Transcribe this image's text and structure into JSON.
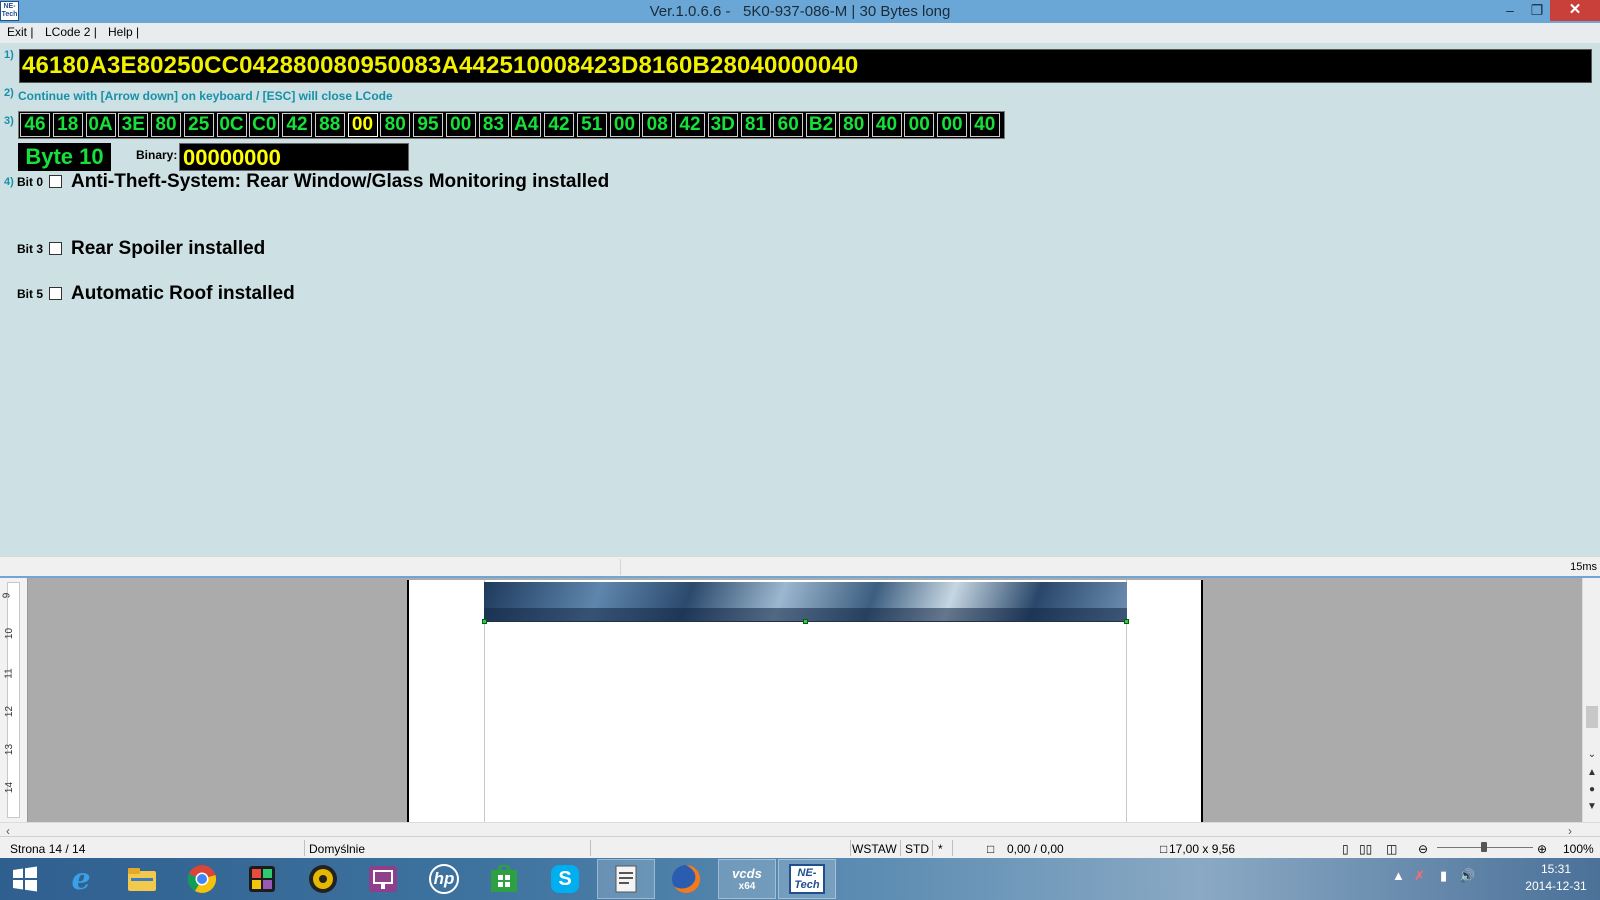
{
  "window": {
    "title": "Ver.1.0.6.6 -   5K0-937-086-M | 30 Bytes long",
    "logo_text": "NE-Tech",
    "minimize_icon": "minimize-icon",
    "maximize_icon": "restore-icon",
    "close_icon": "close-icon"
  },
  "menu": {
    "items": [
      {
        "label": "Exit |"
      },
      {
        "label": "LCode 2 |"
      },
      {
        "label": "Help |"
      }
    ]
  },
  "main": {
    "row_labels": [
      "1)",
      "2)",
      "3)",
      "4)"
    ],
    "coding_string": "46180A3E80250CC042880080950083A442510008423D8160B28040000040",
    "hint": "Continue with [Arrow down] on keyboard / [ESC] will close LCode",
    "bytes": [
      "46",
      "18",
      "0A",
      "3E",
      "80",
      "25",
      "0C",
      "C0",
      "42",
      "88",
      "00",
      "80",
      "95",
      "00",
      "83",
      "A4",
      "42",
      "51",
      "00",
      "08",
      "42",
      "3D",
      "81",
      "60",
      "B2",
      "80",
      "40",
      "00",
      "00",
      "40"
    ],
    "selected_byte_index": 10,
    "byte_label": "Byte 10",
    "binary_label": "Binary:",
    "binary_value": "00000000",
    "bits": [
      {
        "label": "Bit 0",
        "checked": false,
        "description": "Anti-Theft-System: Rear Window/Glass Monitoring installed"
      },
      {
        "label": "Bit 3",
        "checked": false,
        "description": "Rear Spoiler installed"
      },
      {
        "label": "Bit 5",
        "checked": false,
        "description": "Automatic Roof installed"
      }
    ]
  },
  "app_status": {
    "timing": "15ms"
  },
  "editor": {
    "ruler_marks": [
      "9",
      "10",
      "11",
      "12",
      "13",
      "14"
    ]
  },
  "doc_status": {
    "page": "Strona  14 / 14",
    "style": "Domyślnie",
    "insert_mode": "WSTAW",
    "selection_mode": "STD",
    "modified": "*",
    "position": "0,00 / 0,00",
    "size": "17,00 x 9,56",
    "zoom": "100%"
  },
  "taskbar": {
    "items": [
      {
        "icon": "start-icon"
      },
      {
        "icon": "internet-explorer-icon"
      },
      {
        "icon": "file-explorer-icon"
      },
      {
        "icon": "chrome-icon"
      },
      {
        "icon": "paint-app-icon"
      },
      {
        "icon": "media-player-icon"
      },
      {
        "icon": "presentation-app-icon"
      },
      {
        "icon": "hp-icon"
      },
      {
        "icon": "store-icon"
      },
      {
        "icon": "skype-icon"
      },
      {
        "icon": "document-app-icon"
      },
      {
        "icon": "firefox-icon"
      },
      {
        "icon": "vcds-icon",
        "label": "x64"
      },
      {
        "icon": "netech-icon",
        "label": "NE-Tech",
        "active": true
      }
    ],
    "clock_time": "15:31",
    "clock_date": "2014-12-31"
  },
  "colors": {
    "background": "#cde0e3",
    "hex_text": "#f2f200",
    "byte_text": "#16e03a",
    "accent": "#1890a8"
  }
}
